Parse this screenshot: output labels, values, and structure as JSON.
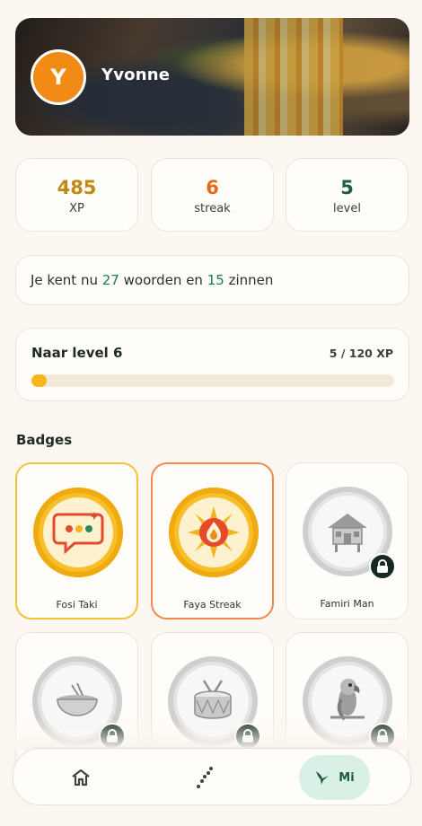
{
  "profile": {
    "initial": "Y",
    "name": "Yvonne"
  },
  "stats": [
    {
      "value": "485",
      "label": "XP",
      "color": "#c18a10"
    },
    {
      "value": "6",
      "label": "streak",
      "color": "#ea6a1c"
    },
    {
      "value": "5",
      "label": "level",
      "color": "#1f5e3f"
    }
  ],
  "known": {
    "prefix": "Je kent nu",
    "words_count": "27",
    "words_text": "woorden en",
    "sentences_count": "15",
    "sentences_text": "zinnen"
  },
  "level_progress": {
    "title": "Naar level 6",
    "xp_text": "5 / 120 XP",
    "current": 5,
    "target": 120
  },
  "badges_section": {
    "title": "Badges"
  },
  "badges": [
    {
      "name": "Fosi Taki",
      "icon": "chat-bubble-icon",
      "state": "earned"
    },
    {
      "name": "Faya Streak",
      "icon": "flame-icon",
      "state": "earned"
    },
    {
      "name": "Famiri Man",
      "icon": "house-icon",
      "state": "locked"
    },
    {
      "name": "",
      "icon": "bowl-icon",
      "state": "locked"
    },
    {
      "name": "",
      "icon": "drum-icon",
      "state": "locked"
    },
    {
      "name": "",
      "icon": "parrot-icon",
      "state": "locked"
    }
  ],
  "nav": {
    "items": [
      {
        "icon": "home-icon"
      },
      {
        "icon": "path-icon"
      },
      {
        "icon": "hummingbird-icon",
        "label": "Mi",
        "active": true
      }
    ]
  }
}
